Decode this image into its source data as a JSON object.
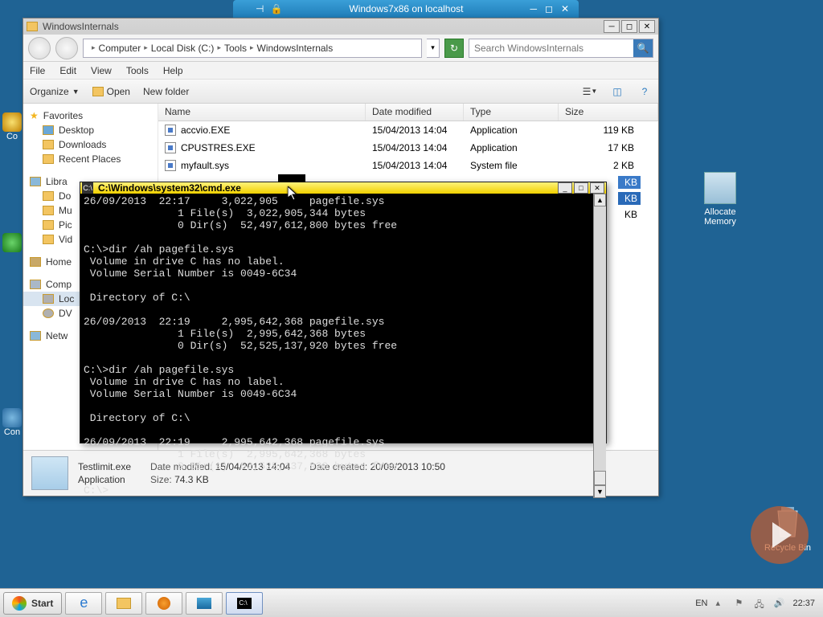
{
  "vm": {
    "title": "Windows7x86 on localhost"
  },
  "explorer": {
    "title": "WindowsInternals",
    "breadcrumb": [
      "Computer",
      "Local Disk (C:)",
      "Tools",
      "WindowsInternals"
    ],
    "search_placeholder": "Search WindowsInternals",
    "menu": {
      "file": "File",
      "edit": "Edit",
      "view": "View",
      "tools": "Tools",
      "help": "Help"
    },
    "toolbar": {
      "organize": "Organize",
      "open": "Open",
      "newfolder": "New folder"
    },
    "columns": {
      "name": "Name",
      "date": "Date modified",
      "type": "Type",
      "size": "Size"
    },
    "sidebar": {
      "favorites": "Favorites",
      "fav_items": {
        "desktop": "Desktop",
        "downloads": "Downloads",
        "recent": "Recent Places"
      },
      "libraries": "Libra",
      "lib_items": {
        "documents": "Do",
        "music": "Mu",
        "pictures": "Pic",
        "videos": "Vid"
      },
      "homegroup": "Home",
      "computer": "Comp",
      "comp_items": {
        "local": "Loc",
        "dvd": "DV"
      },
      "network": "Netw"
    },
    "files": [
      {
        "name": "accvio.EXE",
        "date": "15/04/2013 14:04",
        "type": "Application",
        "size": "119 KB"
      },
      {
        "name": "CPUSTRES.EXE",
        "date": "15/04/2013 14:04",
        "type": "Application",
        "size": "17 KB"
      },
      {
        "name": "myfault.sys",
        "date": "15/04/2013 14:04",
        "type": "System file",
        "size": "2 KB"
      }
    ],
    "partial_sizes": {
      "r0": "KB",
      "r1": "KB",
      "r2": "KB"
    },
    "details": {
      "name": "Testlimit.exe",
      "type": "Application",
      "dm_label": "Date modified:",
      "dm_value": "15/04/2013 14:04",
      "size_label": "Size:",
      "size_value": "74.3 KB",
      "dc_label": "Date created:",
      "dc_value": "20/09/2013 10:50"
    }
  },
  "cmd": {
    "title": "C:\\Windows\\system32\\cmd.exe",
    "output": "26/09/2013  22:17     3,022,905     pagefile.sys\n               1 File(s)  3,022,905,344 bytes\n               0 Dir(s)  52,497,612,800 bytes free\n\nC:\\>dir /ah pagefile.sys\n Volume in drive C has no label.\n Volume Serial Number is 0049-6C34\n\n Directory of C:\\\n\n26/09/2013  22:19     2,995,642,368 pagefile.sys\n               1 File(s)  2,995,642,368 bytes\n               0 Dir(s)  52,525,137,920 bytes free\n\nC:\\>dir /ah pagefile.sys\n Volume in drive C has no label.\n Volume Serial Number is 0049-6C34\n\n Directory of C:\\\n\n26/09/2013  22:19     2,995,642,368 pagefile.sys\n               1 File(s)  2,995,642,368 bytes\n               0 Dir(s)  52,525,137,920 bytes free\n\nC:\\>"
  },
  "desktop": {
    "alloc_line1": "Allocate",
    "alloc_line2": "Memory",
    "recycle": "Recycle Bin"
  },
  "taskbar": {
    "start": "Start",
    "lang": "EN",
    "time": "22:37"
  },
  "watermark": "pluralsight",
  "leftdesk": {
    "c0": "Co",
    "c1": "Con"
  }
}
